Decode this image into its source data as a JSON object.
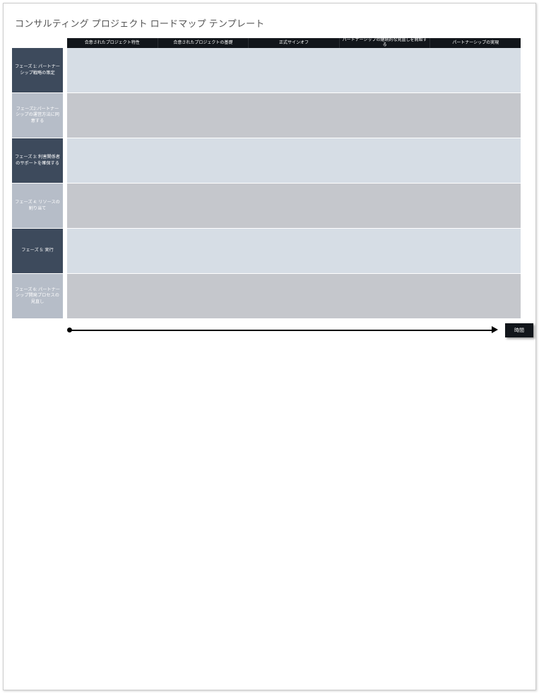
{
  "title": "コンサルティング プロジェクト ロードマップ テンプレート",
  "columns": [
    "合意されたプロジェクト特性",
    "合意されたプロジェクトの基礎",
    "正式サインオフ",
    "パートナーシップの継続的な見直しを開始する",
    "パートナーシップの実現"
  ],
  "phases": [
    {
      "label": "フェーズ 1: パートナーシップ戦略の策定",
      "style": "dark"
    },
    {
      "label": "フェーズ2:パートナーシップの運営方法に同意する",
      "style": "light"
    },
    {
      "label": "フェーズ 3: 利害関係者のサポートを確保する",
      "style": "dark"
    },
    {
      "label": "フェーズ 4: リソースの割り当て",
      "style": "light"
    },
    {
      "label": "フェーズ 5: 実行",
      "style": "dark"
    },
    {
      "label": "フェーズ 6: パートナーシップ開発プロセスの見直し",
      "style": "light"
    }
  ],
  "timeline_label": "時間"
}
